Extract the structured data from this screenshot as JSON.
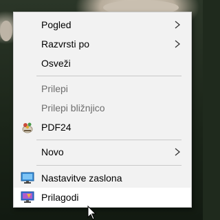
{
  "context_menu": {
    "items": {
      "view": {
        "label": "Pogled"
      },
      "sort_by": {
        "label": "Razvrsti po"
      },
      "refresh": {
        "label": "Osveži"
      },
      "paste": {
        "label": "Prilepi"
      },
      "paste_shortcut": {
        "label": "Prilepi bližnjico"
      },
      "pdf24": {
        "label": "PDF24",
        "icon": "pdf24-icon"
      },
      "new": {
        "label": "Novo"
      },
      "display_settings": {
        "label": "Nastavitve zaslona",
        "icon": "monitor-icon"
      },
      "personalize": {
        "label": "Prilagodi",
        "icon": "personalize-icon"
      }
    },
    "colors": {
      "menu_background": "#f2f2f2",
      "highlight": "#ffffff",
      "disabled_text": "#6d6d6d",
      "separator": "#c8c8c8"
    }
  }
}
